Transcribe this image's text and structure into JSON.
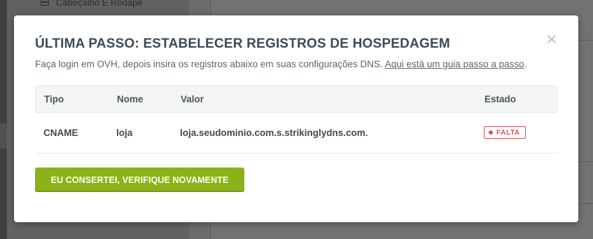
{
  "background": {
    "sidebar_item_label": "Cabeçalho E Rodapé",
    "sidebar_item_icon": "layout-icon"
  },
  "modal": {
    "title": "ÚLTIMA PASSO: ESTABELECER REGISTROS DE HOSPEDAGEM",
    "subtitle_text": "Faça login em OVH, depois insira os registros abaixo em suas configurações DNS. ",
    "subtitle_link": "Aqui está um guia passo a passo",
    "subtitle_end": ".",
    "close_icon": "close-icon",
    "table": {
      "headers": [
        "Tipo",
        "Nome",
        "Valor",
        "Estado"
      ],
      "rows": [
        {
          "tipo": "CNAME",
          "nome": "loja",
          "valor": "loja.seudominio.com.s.strikinglydns.com.",
          "estado": "FALTA"
        }
      ]
    },
    "verify_button": "EU CONSERTEI, VERIFIQUE NOVAMENTE"
  },
  "colors": {
    "accent_green": "#8bb317",
    "missing_red": "#d9525e",
    "title_text": "#3d4a55"
  }
}
